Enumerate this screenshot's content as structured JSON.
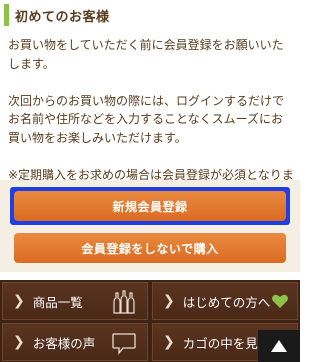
{
  "section": {
    "title": "初めてのお客様"
  },
  "intro": {
    "paragraph1": "お買い物をしていただく前に会員登録をお願いいたします。",
    "paragraph2": "次回からのお買い物の際には、ログインするだけでお名前や住所などを入力することなくスムーズにお買い物をお楽しみいただけます。",
    "paragraph3": "※定期購入をお求めの場合は会員登録が必須となります。"
  },
  "buttons": {
    "register": "新規会員登録",
    "guest_purchase": "会員登録をしないで購入"
  },
  "nav": {
    "items": [
      {
        "label": "商品一覧",
        "icon": "bottles-icon"
      },
      {
        "label": "はじめての方へ",
        "icon": "heart-icon"
      },
      {
        "label": "お客様の声",
        "icon": "speech-bubble-icon"
      },
      {
        "label": "カゴの中を見る",
        "icon": "cart-icon"
      }
    ],
    "pagetop_icon": "up-triangle-icon"
  },
  "colors": {
    "accent_green": "#8bc34a",
    "button_orange": "#e07a2e",
    "focus_blue": "#1f3fe6",
    "nav_brown": "#4a2917",
    "text_brown": "#5a3d1e"
  }
}
